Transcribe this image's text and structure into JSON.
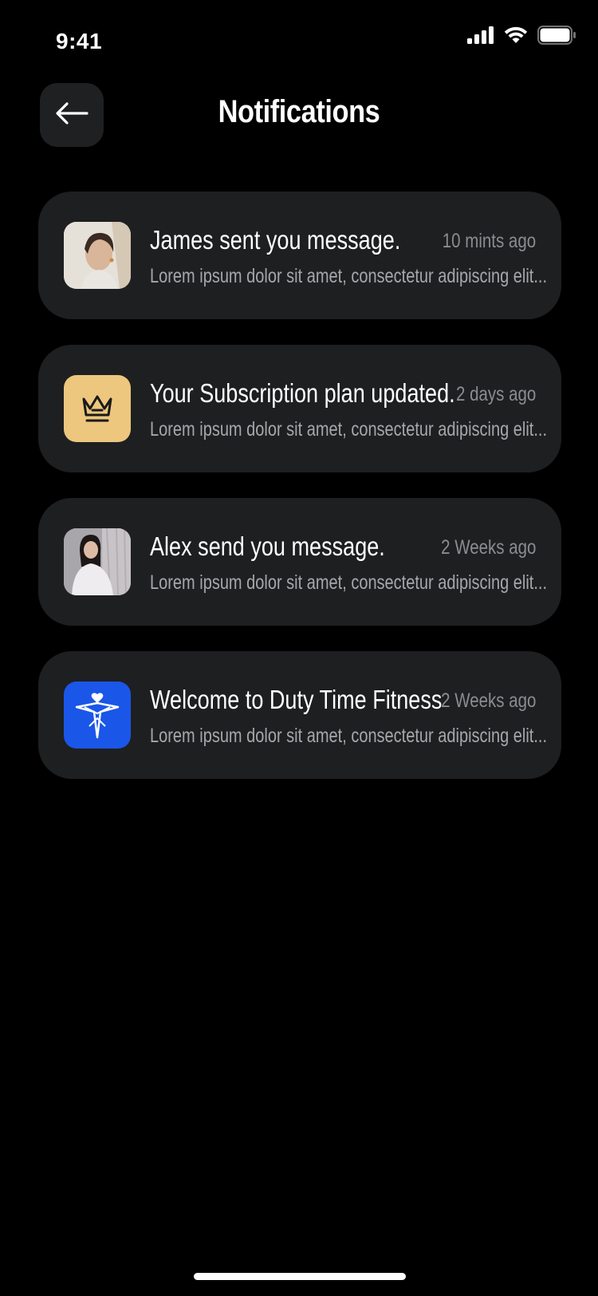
{
  "status_bar": {
    "time": "9:41",
    "icons": [
      "cellular-signal-icon",
      "wifi-icon",
      "battery-icon"
    ]
  },
  "header": {
    "title": "Notifications",
    "back_icon": "arrow-left-icon"
  },
  "notifications": [
    {
      "title": "James sent you message.",
      "time": "10 mints ago",
      "body": "Lorem ipsum dolor sit amet, consectetur adipiscing elit...",
      "avatar": "user-photo-avatar"
    },
    {
      "title": "Your Subscription plan updated.",
      "time": "2 days ago",
      "body": "Lorem ipsum dolor sit amet, consectetur adipiscing elit...",
      "avatar": "crown-icon"
    },
    {
      "title": "Alex send you message.",
      "time": "2 Weeks ago",
      "body": "Lorem ipsum dolor sit amet, consectetur adipiscing elit...",
      "avatar": "user-photo-avatar"
    },
    {
      "title": "Welcome to Duty Time Fitness",
      "time": "2 Weeks ago",
      "body": "Lorem ipsum dolor sit amet, consectetur adipiscing elit...",
      "avatar": "app-logo-icon"
    }
  ],
  "colors": {
    "background": "#000000",
    "card": "#1e1f21",
    "accent_gold": "#ecc77d",
    "brand_blue": "#1a56e8",
    "muted_text": "#8c8c90"
  }
}
